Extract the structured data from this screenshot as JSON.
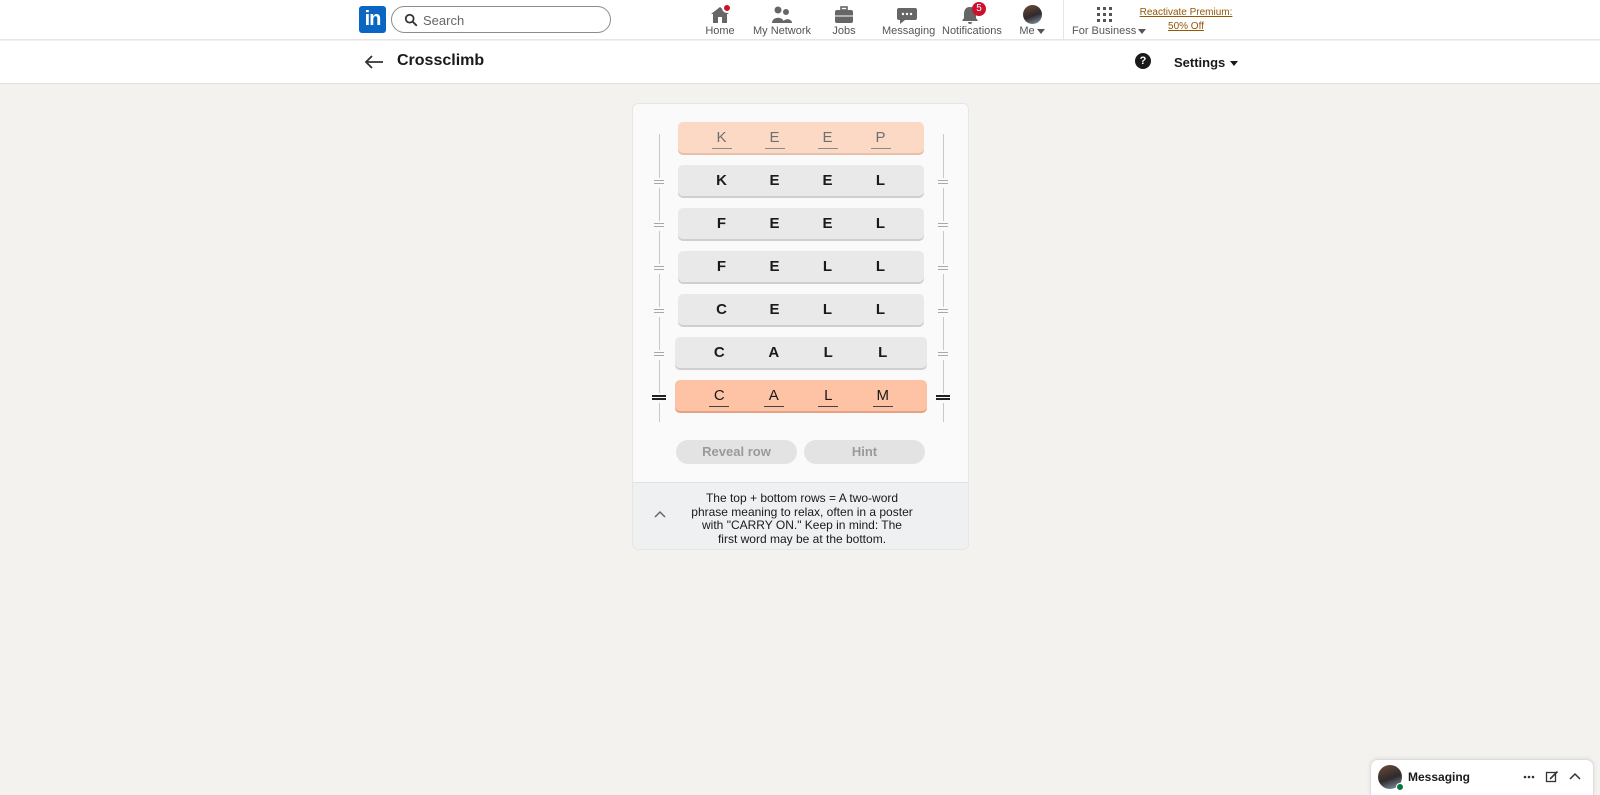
{
  "nav": {
    "search_placeholder": "Search",
    "items": [
      {
        "label": "Home"
      },
      {
        "label": "My Network"
      },
      {
        "label": "Jobs"
      },
      {
        "label": "Messaging"
      },
      {
        "label": "Notifications",
        "badge": "5"
      },
      {
        "label": "Me"
      },
      {
        "label": "For Business"
      }
    ],
    "premium_line1": "Reactivate Premium:",
    "premium_line2": "50% Off",
    "brand_color": "#0a66c2",
    "badge_color": "#cb112d"
  },
  "header": {
    "title": "Crossclimb",
    "help_glyph": "?",
    "settings_label": "Settings"
  },
  "game": {
    "rows": [
      {
        "letters": [
          "K",
          "E",
          "E",
          "P"
        ],
        "kind": "endpoint"
      },
      {
        "letters": [
          "K",
          "E",
          "E",
          "L"
        ],
        "kind": "middle"
      },
      {
        "letters": [
          "F",
          "E",
          "E",
          "L"
        ],
        "kind": "middle"
      },
      {
        "letters": [
          "F",
          "E",
          "L",
          "L"
        ],
        "kind": "middle"
      },
      {
        "letters": [
          "C",
          "E",
          "L",
          "L"
        ],
        "kind": "middle"
      },
      {
        "letters": [
          "C",
          "A",
          "L",
          "L"
        ],
        "kind": "middle"
      },
      {
        "letters": [
          "C",
          "A",
          "L",
          "M"
        ],
        "kind": "endpoint"
      }
    ],
    "reveal_label": "Reveal row",
    "hint_label": "Hint",
    "clue": "The top + bottom rows = A two-word phrase meaning to relax, often in a poster with \"CARRY ON.\" Keep in mind: The first word may be at the bottom.",
    "endpoint_color": "#fdc3a4",
    "tile_color": "#e9e9e9"
  },
  "messaging": {
    "title": "Messaging"
  }
}
